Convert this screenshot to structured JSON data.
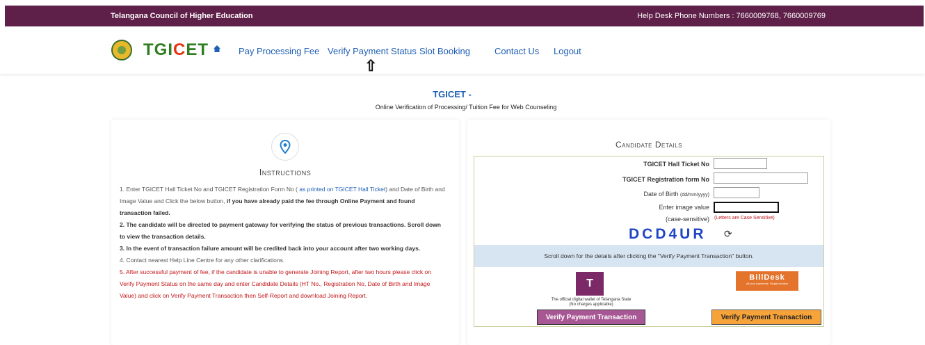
{
  "topbar": {
    "org_name": "Telangana Council of Higher Education",
    "helpdesk": "Help Desk Phone Numbers : 7660009768, 7660009769"
  },
  "nav": {
    "logo_text_a": "TGI",
    "logo_text_c": "C",
    "logo_text_b": "ET",
    "home_icon": "home-icon",
    "items": [
      {
        "label": "Pay Processing Fee"
      },
      {
        "label": "Verify Payment Status"
      },
      {
        "label": "Slot Booking"
      },
      {
        "label": "Contact Us"
      },
      {
        "label": "Logout"
      }
    ],
    "pointer_arrow": "⇧"
  },
  "page": {
    "title": "TGICET -",
    "subtitle": "Online Verification of Processing/ Tuition Fee for Web Counseling"
  },
  "instructions": {
    "heading": "Instructions",
    "items": [
      {
        "n": "1.",
        "a": "Enter TGICET Hall Ticket No and TGICET Registration Form No (",
        "b": "as printed on TGICET Hall Ticket",
        "c": ") and Date of Birth and Image Value and Click the below button,",
        "d": "if you have already paid the fee through Online Payment and found transaction failed."
      },
      {
        "n": "2.",
        "text": "The candidate will be directed to payment gateway for verifying the status of previous transactions. Scroll down to view the transaction details."
      },
      {
        "n": "3.",
        "text": "In the event of transaction failure amount will be credited back into your account after two working days."
      },
      {
        "n": "4.",
        "text": "Contact nearest Help Line Centre for any other clarifications."
      },
      {
        "n": "5.",
        "text": "After successful payment of fee, if the candidate is unable to generate Joining Report, after two hours please click on Verify Payment Status on the same day and enter Candidate Details (HT No., Registration No, Date of Birth and Image Value) and click on Verify Payment Transaction then Self-Report and download Joining Report."
      }
    ]
  },
  "candidate": {
    "heading": "Candidate Details",
    "hall_ticket_label": "TGICET Hall Ticket No",
    "reg_label": "TGICET Registration form No",
    "dob_label": "Date of Birth",
    "dob_format": "(dd/mm/yyyy)",
    "image_label": "Enter image value",
    "case_label": "(case-sensitive)",
    "case_note": "(Letters are Case Sensitive)",
    "captcha": "DCD4UR",
    "note": "Scroll down for the details after clicking the \"Verify Payment Transaction\" button.",
    "twallet_caption_1": "The official digital wallet of Telangana State",
    "twallet_caption_2": "(No charges applicable)",
    "billdesk_logo": "BillDesk",
    "billdesk_tagline": "All your payments. Single location",
    "verify_btn_1": "Verify Payment Transaction",
    "verify_btn_2": "Verify Payment Transaction"
  },
  "colors": {
    "topbar": "#5e1f48",
    "link": "#1f5fb5",
    "alert": "#c0171a",
    "note_band": "#d7e5f3",
    "twallet": "#a75794",
    "billdesk": "#f6a33a"
  }
}
